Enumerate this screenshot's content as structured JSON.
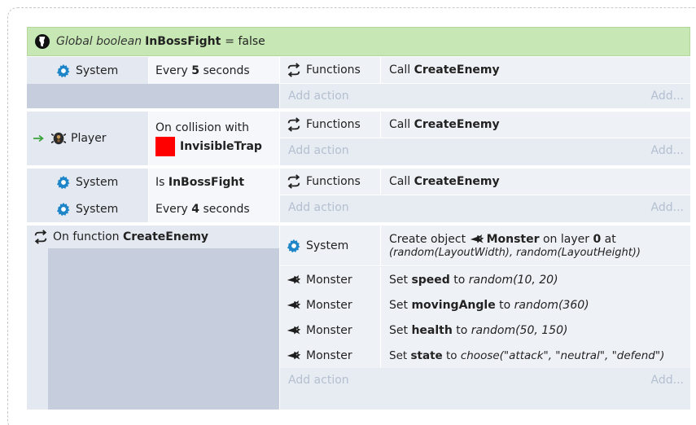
{
  "global_var": {
    "prefix": "Global boolean",
    "name": "InBossFight",
    "assign": "= false"
  },
  "events": [
    {
      "conditions": [
        {
          "object": "System",
          "pre": "Every ",
          "bold": "5",
          "post": " seconds"
        }
      ],
      "actions": [
        {
          "object": "Functions",
          "pre": "Call ",
          "bold": "CreateEnemy"
        }
      ]
    },
    {
      "conditions": [
        {
          "object": "Player",
          "line1": "On collision with",
          "bold": "InvisibleTrap"
        }
      ],
      "actions": [
        {
          "object": "Functions",
          "pre": "Call ",
          "bold": "CreateEnemy"
        }
      ]
    },
    {
      "conditions": [
        {
          "object": "System",
          "pre": "Is ",
          "bold": "InBossFight",
          "post": ""
        },
        {
          "object": "System",
          "pre": "Every ",
          "bold": "4",
          "post": " seconds"
        }
      ],
      "actions": [
        {
          "object": "Functions",
          "pre": "Call ",
          "bold": "CreateEnemy"
        }
      ]
    }
  ],
  "function_block": {
    "head_pre": "On function ",
    "head_bold": "CreateEnemy",
    "actions": [
      {
        "object": "System",
        "line1_pre": "Create object ",
        "line1_obj": "Monster",
        "line1_mid": " on layer ",
        "line1_bold": "0",
        "line1_post": " at",
        "line2": "(random(LayoutWidth), random(LayoutHeight))"
      },
      {
        "object": "Monster",
        "pre": "Set ",
        "bold": "speed",
        "mid": " to ",
        "ital": "random(10, 20)"
      },
      {
        "object": "Monster",
        "pre": "Set ",
        "bold": "movingAngle",
        "mid": " to ",
        "ital": "random(360)"
      },
      {
        "object": "Monster",
        "pre": "Set ",
        "bold": "health",
        "mid": " to ",
        "ital": "random(50, 150)"
      },
      {
        "object": "Monster",
        "pre": "Set ",
        "bold": "state",
        "mid": " to ",
        "ital": "choose(\"attack\", \"neutral\", \"defend\")"
      }
    ]
  },
  "add_action": "Add action",
  "add_more": "Add...",
  "icons": {
    "globe": "globe-icon",
    "system": "gear-icon",
    "functions": "function-arrows-icon",
    "player": "player-sprite-icon",
    "monster": "monster-sprite-icon",
    "trigger": "trigger-arrow-icon"
  },
  "colors": {
    "global_bg": "#c7e8b5",
    "condition_bg": "#c6cede",
    "action_bg": "#e7ecf3",
    "gear": "#1e86c8",
    "trap": "#ff0000"
  }
}
